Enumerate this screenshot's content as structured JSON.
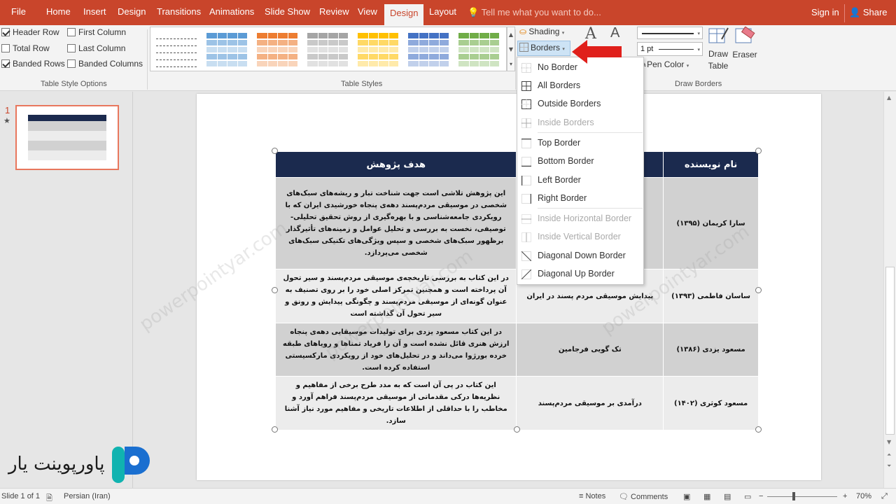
{
  "app": {
    "tabs": [
      "File",
      "Home",
      "Insert",
      "Design",
      "Transitions",
      "Animations",
      "Slide Show",
      "Review",
      "View",
      "Design",
      "Layout"
    ],
    "active_tab": "Design",
    "tell_me": "Tell me what you want to do...",
    "sign_in": "Sign in",
    "share": "Share"
  },
  "ribbon": {
    "table_style_options": {
      "label": "Table Style Options",
      "options": [
        {
          "label": "Header Row",
          "checked": true
        },
        {
          "label": "First Column",
          "checked": false
        },
        {
          "label": "Total Row",
          "checked": false
        },
        {
          "label": "Last Column",
          "checked": false
        },
        {
          "label": "Banded Rows",
          "checked": true
        },
        {
          "label": "Banded Columns",
          "checked": false
        }
      ]
    },
    "table_styles": {
      "label": "Table Styles",
      "swatches": [
        "#ffffff",
        "#5b9bd5",
        "#ed7d31",
        "#a5a5a5",
        "#ffc000",
        "#4472c4",
        "#70ad47"
      ]
    },
    "shading": "Shading",
    "borders": "Borders",
    "pen_weight": "1 pt",
    "pen_color": "Pen Color",
    "draw_table": "Draw Table",
    "draw_table_l1": "Draw",
    "draw_table_l2": "Table",
    "eraser": "Eraser",
    "draw_borders_label": "Draw Borders"
  },
  "borders_menu": {
    "items": [
      {
        "label": "No Border",
        "enabled": true
      },
      {
        "label": "All Borders",
        "enabled": true
      },
      {
        "label": "Outside Borders",
        "enabled": true
      },
      {
        "label": "Inside Borders",
        "enabled": false
      },
      {
        "label": "Top Border",
        "enabled": true
      },
      {
        "label": "Bottom Border",
        "enabled": true
      },
      {
        "label": "Left Border",
        "enabled": true
      },
      {
        "label": "Right Border",
        "enabled": true
      },
      {
        "label": "Inside Horizontal Border",
        "enabled": false
      },
      {
        "label": "Inside Vertical Border",
        "enabled": false
      },
      {
        "label": "Diagonal Down Border",
        "enabled": true
      },
      {
        "label": "Diagonal Up Border",
        "enabled": true
      }
    ]
  },
  "slides_pane": {
    "number": "1",
    "star": "★"
  },
  "table": {
    "headers": [
      "نام نویسنده",
      "",
      "هدف پژوهش"
    ],
    "rows": [
      {
        "author": "سارا کریمان (۱۳۹۵)",
        "title": "",
        "goal": "این پژوهش تلاشی است جهت شناخت تبار و ریشه‌های سبک‌های شخصی در موسیقی مردم‌پسند دهه‌ی پنجاه خورشیدی ایران که با رویکردی جامعه‌شناسی و با بهره‌گیری از روش تحقیق تحلیلی-توصیفی، نخست به بررسی و تحلیل عوامل و زمینه‌های تأثیرگذار برظهور سبک‌های شخصی و سپس ویژگی‌های تکنیکی سبک‌های شخصی می‌پردازد."
      },
      {
        "author": "ساسان فاطمی (۱۳۹۳)",
        "title": "پیدایش موسیقی مردم پسند در ایران",
        "goal": "در این کتاب به بررسی تاریخچه‌ی موسیقی مردم‌پسند و سیر تحول آن پرداخته است و همچنین تمرکز اصلی خود را بر روی تصنیف به عنوان گونه‌ای از موسیقی مردم‌پسند و چگونگی پیدایش و رونق و سیر تحول آن گذاشته است"
      },
      {
        "author": "مسعود یزدی (۱۳۸۶)",
        "title": "تک گویی فرجامین",
        "goal": "در این کتاب مسعود یزدی برای تولیدات موسیقایی دهه‌ی پنجاه ارزش هنری قائل نشده است و آن را فریاد تمناها و رویاهای طبقه خرده بورژوا می‌داند و در تحلیل‌های خود از رویکردی مارکسیستی استفاده کرده است."
      },
      {
        "author": "مسعود کوثری (۱۴۰۲)",
        "title": "درآمدی بر موسیقی مردم‌پسند",
        "goal": "این کتاب در پی آن است که به مدد طرح برخی از مفاهیم و نظریه‌ها درکی مقدماتی از موسیقی مردم‌پسند فراهم آورد و مخاطب را با حداقلی از اطلاعات تاریخی و مفاهیم مورد نیاز آشنا سازد."
      }
    ]
  },
  "watermark": "powerpointyar.com",
  "logo": "پاورپوینت یار",
  "status": {
    "slide_info": "Slide 1 of 1",
    "language": "Persian (Iran)",
    "notes": "Notes",
    "comments": "Comments",
    "zoom": "70%"
  },
  "colors": {
    "tab_bar": "#c9452b",
    "table_header": "#1b2a4e",
    "band_dark": "#d1d1d1",
    "band_light": "#ececec",
    "arrow": "#e0201b"
  }
}
